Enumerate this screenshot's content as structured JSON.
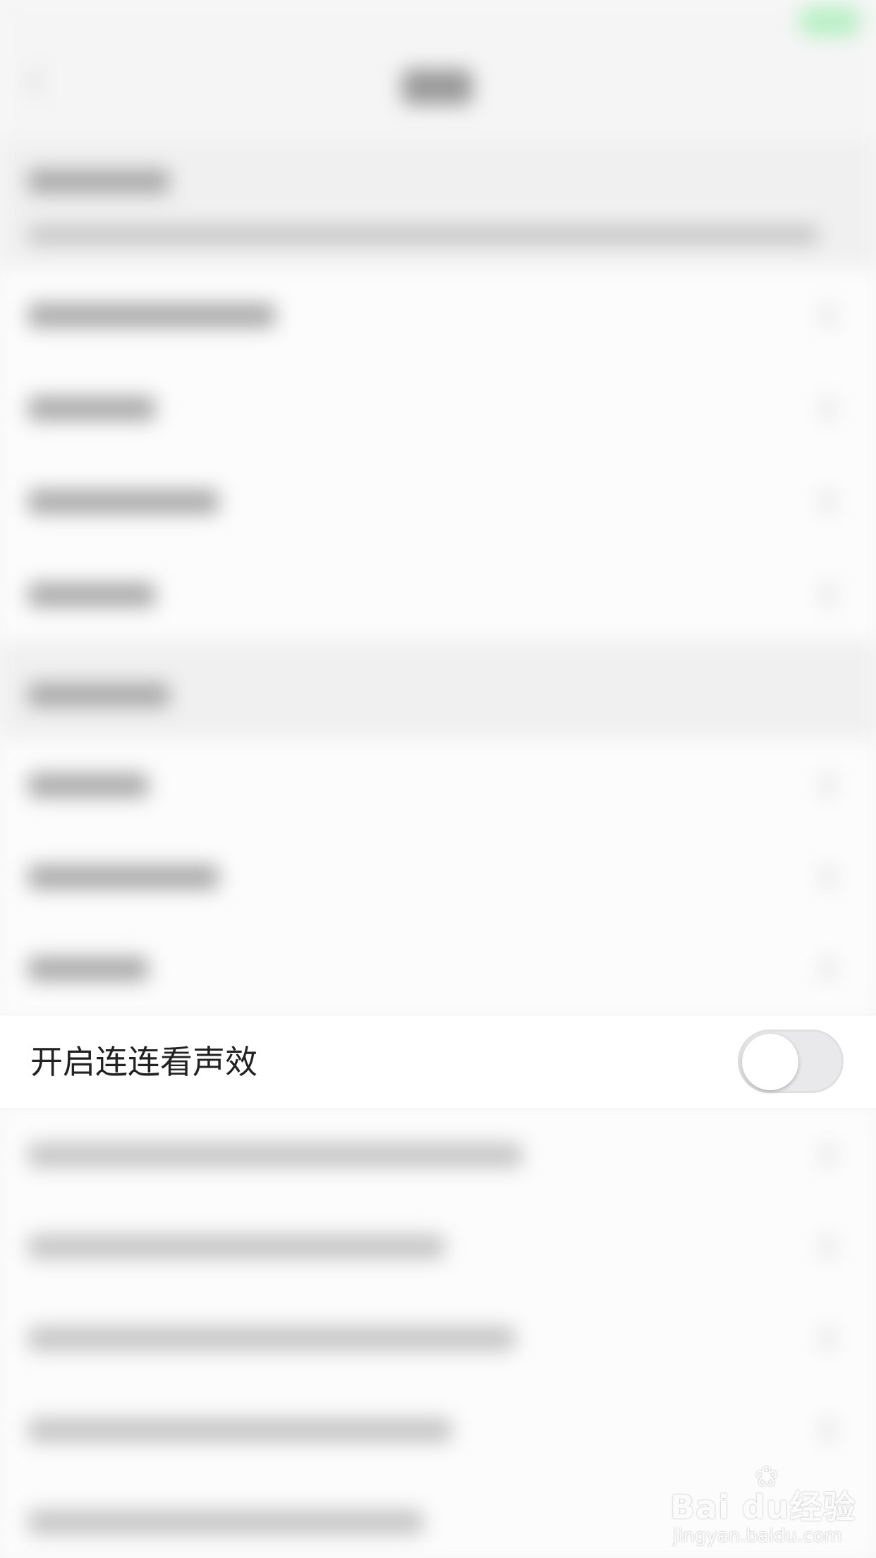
{
  "setting_row": {
    "label": "开启连连看声效",
    "toggle_on": false
  },
  "watermark": {
    "brand": "Bai du经验",
    "url": "jingyan.baidu.com"
  }
}
